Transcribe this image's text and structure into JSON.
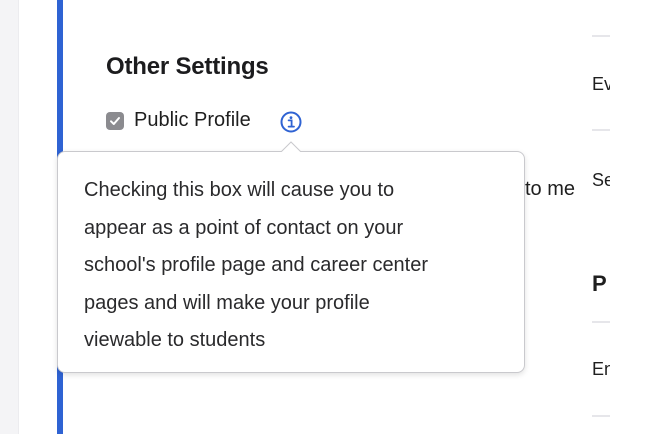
{
  "section": {
    "title": "Other Settings",
    "public_profile": {
      "label": "Public Profile",
      "checked": true,
      "info_icon": "info-circle-icon"
    }
  },
  "tooltip": {
    "lines": [
      "Checking this box will cause you to",
      "appear as a point of contact on your",
      "school's profile page and career center",
      "pages and will make your profile",
      "viewable to students"
    ]
  },
  "obscured_text": "to me",
  "right_column": {
    "items": [
      "Ev",
      "Se",
      "P",
      "En"
    ]
  },
  "colors": {
    "accent": "#2f63d3",
    "checkbox": "#8b8b8f",
    "info_icon": "#2f63d3"
  }
}
